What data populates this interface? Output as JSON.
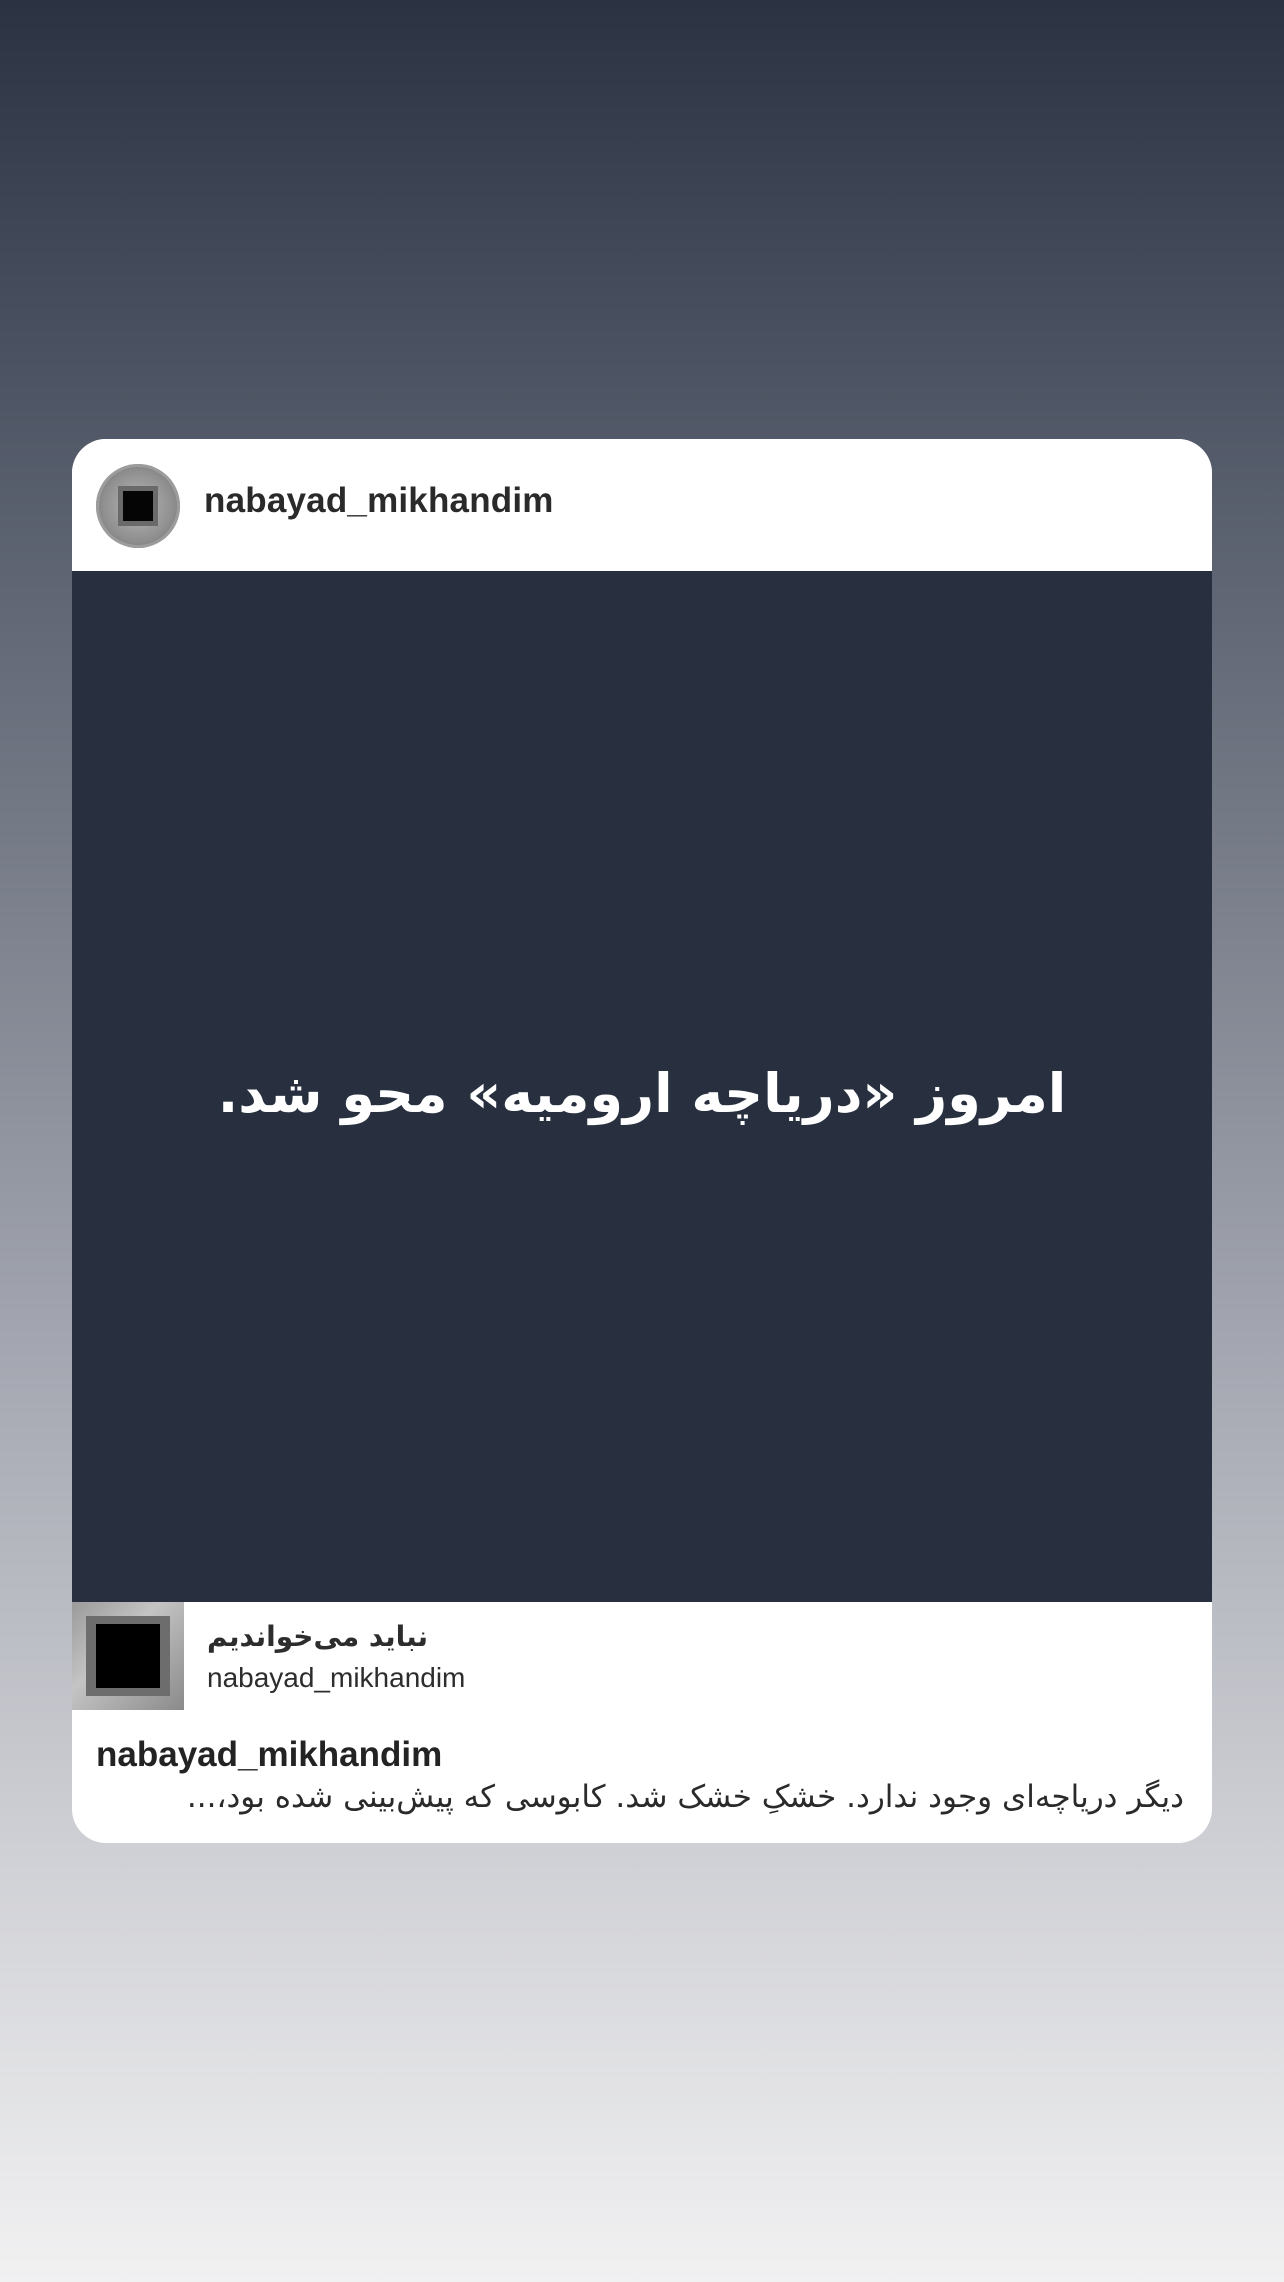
{
  "header": {
    "username": "nabayad_mikhandim",
    "avatar_icon": "black-square-icon"
  },
  "post": {
    "text": "امروز «دریاچه ارومیه» محو شد.",
    "background_color": "#283040"
  },
  "attribution": {
    "title": "نباید می‌خواندیم",
    "username": "nabayad_mikhandim",
    "thumbnail_icon": "black-square-icon"
  },
  "caption": {
    "username": "nabayad_mikhandim",
    "text": "دیگر دریاچه‌ای وجود ندارد. خشکِ خشک شد. کابوسی که پیش‌بینی شده بود،..."
  }
}
